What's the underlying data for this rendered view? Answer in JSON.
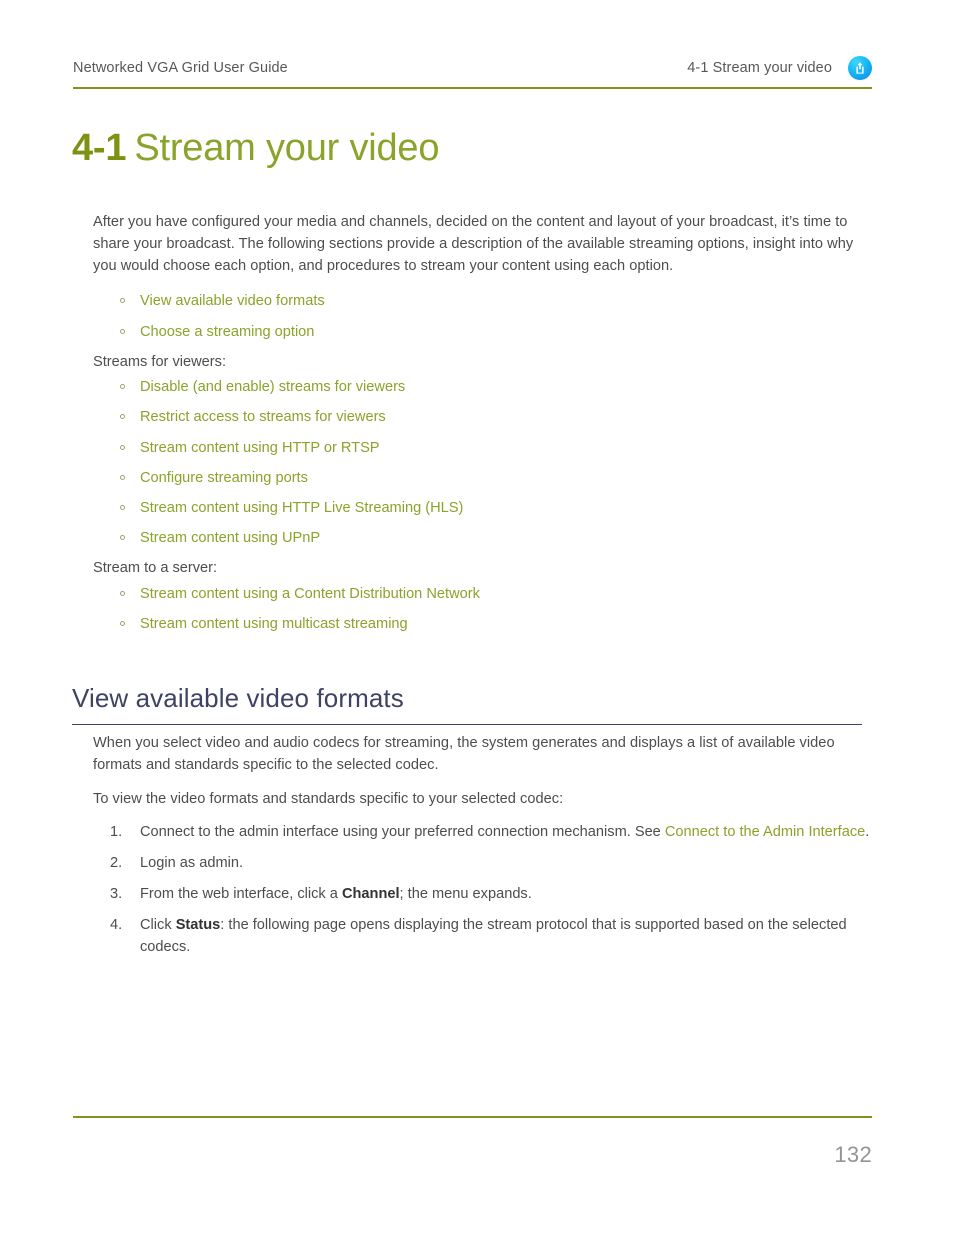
{
  "header": {
    "left_text": "Networked VGA Grid User Guide",
    "right_text": "4-1 Stream your video",
    "logo_icon": "share-upload-icon",
    "rule_color": "#84941b"
  },
  "title": {
    "number": "4-1",
    "text": "Stream your video",
    "number_color": "#7d9212",
    "text_color": "#8aa32b"
  },
  "intro": {
    "paragraph": "After you have configured your media and channels, decided on the content and layout of your broadcast, it’s time to share your broadcast. The following sections provide a description of the available streaming options, insight into why you would choose each option, and procedures to stream your content using each option."
  },
  "top_links": [
    {
      "label": "View available video formats"
    },
    {
      "label": "Choose a streaming option"
    }
  ],
  "viewers_section": {
    "label": "Streams for viewers:",
    "links": [
      {
        "label": "Disable (and enable) streams for viewers"
      },
      {
        "label": "Restrict access to streams for viewers"
      },
      {
        "label": "Stream content using HTTP or RTSP"
      },
      {
        "label": "Configure streaming ports"
      },
      {
        "label": "Stream content using HTTP Live Streaming (HLS)"
      },
      {
        "label": "Stream content using UPnP"
      }
    ]
  },
  "server_section": {
    "label": "Stream to a server:",
    "links": [
      {
        "label": "Stream content using a Content Distribution Network"
      },
      {
        "label": "Stream content using multicast streaming"
      }
    ]
  },
  "section": {
    "heading": "View available video formats",
    "heading_color": "#3e4363",
    "paragraph_1": "When you select video and audio codecs for streaming, the system generates and displays a list of available video formats and standards specific to the selected codec.",
    "paragraph_2": "To view the video formats and standards specific to your selected codec:"
  },
  "steps": {
    "step1_prefix": "Connect to the admin interface using your preferred connection mechanism. See ",
    "step1_link": "Connect to the Admin Interface",
    "step1_suffix": ".",
    "step2": "Login as admin.",
    "step3_prefix": "From the web interface, click a ",
    "step3_bold": "Channel",
    "step3_suffix": "; the menu expands.",
    "step4_prefix": "Click ",
    "step4_bold": "Status",
    "step4_suffix": ": the following page opens displaying the stream protocol that is supported based on the selected codecs."
  },
  "footer": {
    "page_number": "132",
    "rule_color": "#84941b"
  }
}
